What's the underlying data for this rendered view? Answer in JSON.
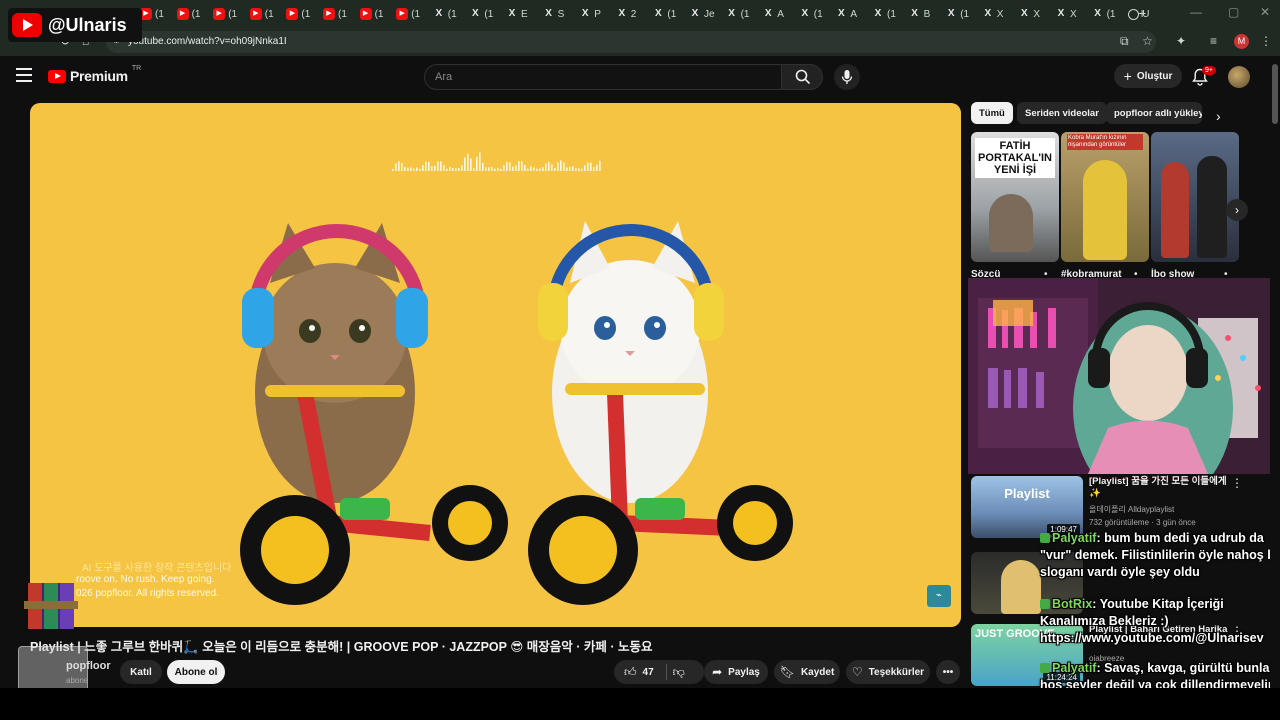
{
  "watermark": {
    "handle": "@Ulnaris"
  },
  "browser": {
    "tabs": [
      {
        "icon": "yt",
        "label": "(1"
      },
      {
        "icon": "yt",
        "label": "(1"
      },
      {
        "icon": "yt",
        "label": "(1"
      },
      {
        "icon": "yt",
        "label": "(1"
      },
      {
        "icon": "yt",
        "label": "(1"
      },
      {
        "icon": "yt",
        "label": "(1"
      },
      {
        "icon": "yt",
        "label": "(1"
      },
      {
        "icon": "yt",
        "label": "(1"
      },
      {
        "icon": "x",
        "label": "(1"
      },
      {
        "icon": "x",
        "label": "(1"
      },
      {
        "icon": "x",
        "label": "E"
      },
      {
        "icon": "x",
        "label": "S"
      },
      {
        "icon": "x",
        "label": "P"
      },
      {
        "icon": "x",
        "label": "2"
      },
      {
        "icon": "x",
        "label": "(1"
      },
      {
        "icon": "x",
        "label": "Je"
      },
      {
        "icon": "x",
        "label": "(1"
      },
      {
        "icon": "x",
        "label": "A"
      },
      {
        "icon": "x",
        "label": "(1"
      },
      {
        "icon": "x",
        "label": "A"
      },
      {
        "icon": "x",
        "label": "(1"
      },
      {
        "icon": "x",
        "label": "B"
      },
      {
        "icon": "x",
        "label": "(1"
      },
      {
        "icon": "x",
        "label": "X"
      },
      {
        "icon": "x",
        "label": "X"
      },
      {
        "icon": "x",
        "label": "X"
      },
      {
        "icon": "x",
        "label": "(1"
      },
      {
        "icon": "g",
        "label": "U"
      }
    ],
    "new_tab": "+",
    "url": "youtube.com/watch?v=oh09jNnka1I",
    "profile_initial": "M"
  },
  "header": {
    "brand": "Premium",
    "country": "TR",
    "search_placeholder": "Ara",
    "create_label": "Oluştur",
    "notif_count": "9+"
  },
  "video": {
    "overlay_korean": "AI 도구를 사용한 창작 콘텐츠입니다",
    "overlay_line1": "roove on. No rush. Keep going.",
    "overlay_line2": "026 popfloor. All rights reserved.",
    "title": "Playlist | 느좋 그루브 한바퀴🛴 오늘은 이 리듬으로 충분해! | GROOVE POP · JAZZPOP 😎 매장음악 · 카페 · 노동요",
    "channel": "popfloor",
    "subs": "abone",
    "join": "Katıl",
    "subscribe": "Abone ol",
    "likes": "47",
    "share": "Paylaş",
    "save": "Kaydet",
    "thanks": "Teşekkürler"
  },
  "sidebar": {
    "chips": [
      "Tümü",
      "Seriden videolar",
      "popfloor adlı yükleyici"
    ],
    "shorts": [
      {
        "label": "Sözcü",
        "caption": "FATİH PORTAKAL'IN YENİ İŞİ"
      },
      {
        "label": "#kobramurat",
        "caption": "Kobra Murat'ın kızının nişanından görüntüler"
      },
      {
        "label": "İbo show",
        "caption": ""
      }
    ],
    "recs": [
      {
        "title": "[Playlist] 꿈을 가진 모든 이들에게✨",
        "channel": "올데이플리 Alldayplaylist",
        "meta": "732 görüntüleme · 3 gün önce",
        "duration": "1:09:47",
        "thumb_text": "Playlist"
      },
      {
        "title": "",
        "channel": "",
        "meta": "",
        "duration": "",
        "thumb_text": ""
      },
      {
        "title": "Playlist | Baharı Getiren Harika",
        "channel": "oiabreeze",
        "meta": "",
        "duration": "11:24:24",
        "thumb_text": "JUST GROOVE"
      }
    ]
  },
  "chat": [
    {
      "user": "Palyatif",
      "text": ": bum bum dedi ya udrub da \"vur\" demek. Filistinlilerin öyle nahoş bi sloganı vardı öyle şey oldu"
    },
    {
      "user": "BotRix",
      "text": ": Youtube Kitap İçeriği Kanalımıza Bekleriz :) https://www.youtube.com/@Ulnarisev"
    },
    {
      "user": "Palyatif",
      "text": ": Savaş, kavga, gürültü bunlar hoş şeyler değil ya çok dillendirmeyelim neyse :d"
    }
  ],
  "colors": {
    "accent": "#ff0000",
    "player_bg": "#f5c443",
    "chat_user": "#7ddc5a"
  }
}
